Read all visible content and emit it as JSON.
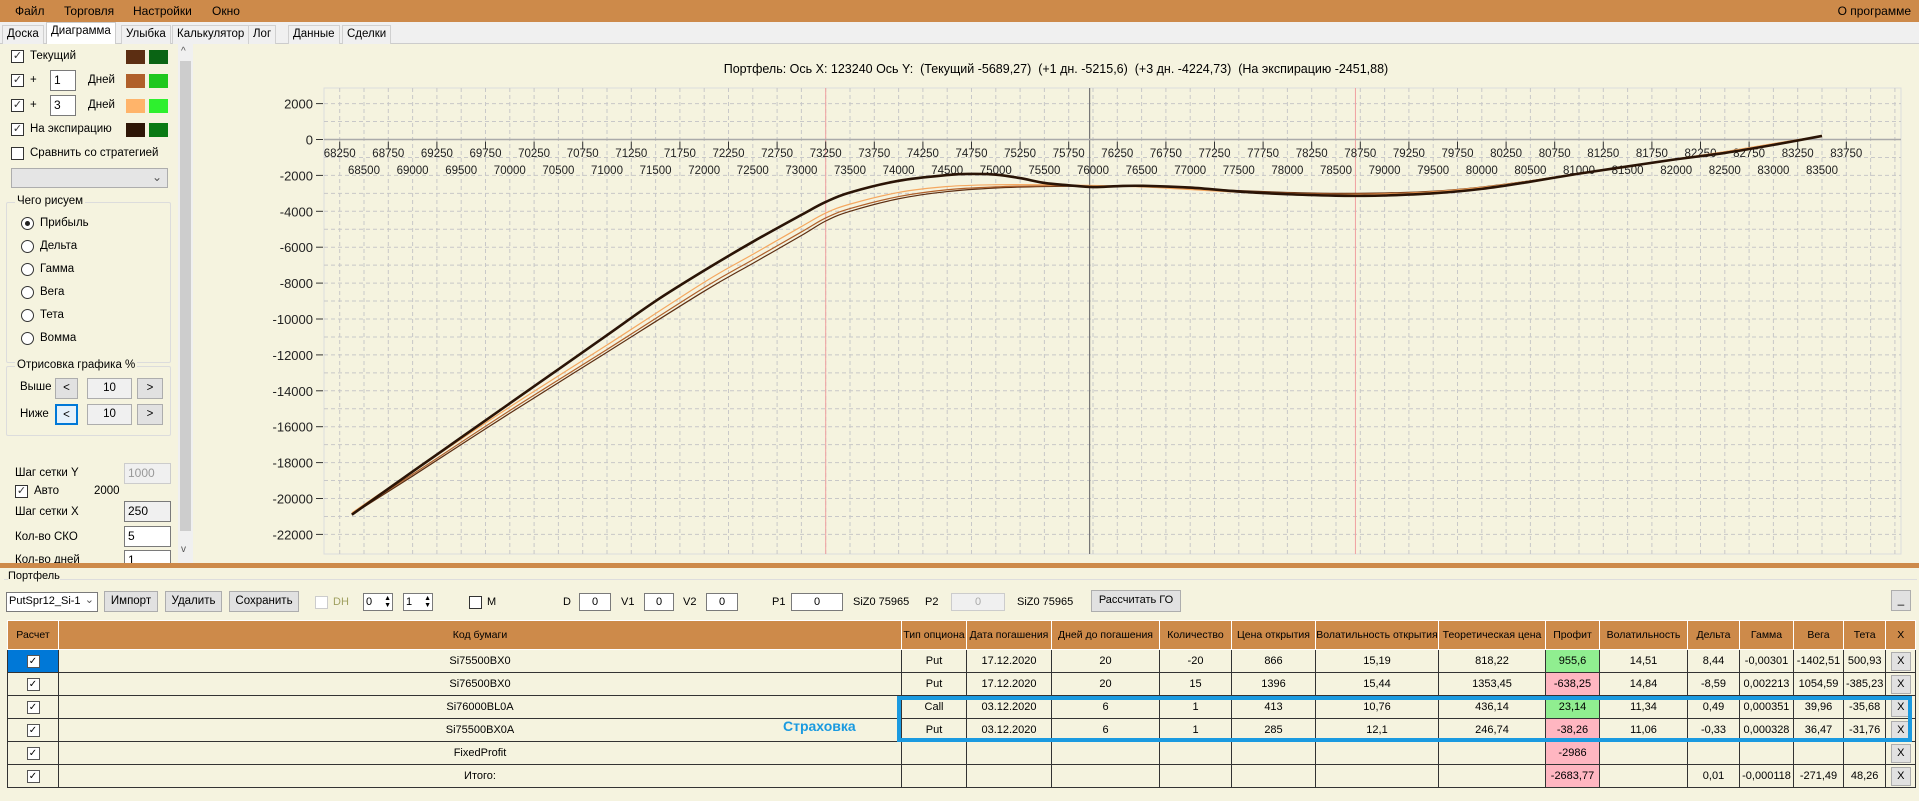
{
  "menu": {
    "items": [
      "Файл",
      "Торговля",
      "Настройки",
      "Окно"
    ],
    "about": "О программе"
  },
  "tabs": [
    "Доска",
    "Диаграмма",
    "Улыбка",
    "Калькулятор",
    "Лог",
    "Данные",
    "Сделки"
  ],
  "active_tab": "Диаграмма",
  "left_panel": {
    "series_rows": [
      {
        "label": "Текущий",
        "checked": true,
        "color1": "#5c2e12",
        "color2": "#0a6414"
      },
      {
        "label": "+",
        "days": "1",
        "days_label": "Дней",
        "checked": true,
        "color1": "#b0602a",
        "color2": "#1ec81e"
      },
      {
        "label": "+",
        "days": "3",
        "days_label": "Дней",
        "checked": true,
        "color1": "#ffb46a",
        "color2": "#2ef02e"
      },
      {
        "label": "На экспирацию",
        "checked": true,
        "color1": "#2e1606",
        "color2": "#0a7a14"
      }
    ],
    "compare_label": "Сравнить со стратегией",
    "compare_value": "",
    "draw_group": {
      "title": "Чего рисуем",
      "options": [
        "Прибыль",
        "Дельта",
        "Гамма",
        "Вега",
        "Тета",
        "Вомма"
      ],
      "selected": "Прибыль"
    },
    "range_group": {
      "title": "Отрисовка графика %",
      "above_label": "Выше",
      "above_value": "10",
      "below_label": "Ниже",
      "below_value": "10",
      "dec": "<",
      "inc": ">"
    },
    "grid_y_label": "Шаг сетки Y",
    "grid_y_value": "1000",
    "auto_label": "Авто",
    "auto_value": "2000",
    "grid_x_label": "Шаг сетки X",
    "grid_x_value": "250",
    "sko_label": "Кол-во СКО",
    "sko_value": "5",
    "days_label": "Кол-во дней",
    "days_value": "1"
  },
  "chart_title": "Портфель: Ось X: 123240 Ось Y:  (Текущий -5689,27)  (+1 дн. -5215,6)  (+3 дн. -4224,73)  (На экспирацию -2451,88)",
  "chart_data": {
    "type": "line",
    "xlim": [
      68250,
      83750
    ],
    "ylim": [
      -22000,
      2000
    ],
    "x_ticks_top": [
      "68250",
      "68750",
      "69250",
      "69750",
      "70250",
      "70750",
      "71250",
      "71750",
      "72250",
      "72750",
      "73250",
      "73750",
      "74250",
      "74750",
      "75250",
      "75750",
      "76250",
      "76750",
      "77250",
      "77750",
      "78250",
      "78750",
      "79250",
      "79750",
      "80250",
      "80750",
      "81250",
      "81750",
      "82250",
      "82750",
      "83250",
      "83750"
    ],
    "x_ticks_bottom": [
      "68500",
      "69000",
      "69500",
      "70000",
      "70500",
      "71000",
      "71500",
      "72000",
      "72500",
      "73000",
      "73500",
      "74000",
      "74500",
      "75000",
      "75500",
      "76000",
      "76500",
      "77000",
      "77500",
      "78000",
      "78500",
      "79000",
      "79500",
      "80000",
      "80500",
      "81000",
      "81500",
      "82000",
      "82500",
      "83000",
      "83500"
    ],
    "y_ticks": [
      "2000",
      "0",
      "-2000",
      "-4000",
      "-6000",
      "-8000",
      "-10000",
      "-12000",
      "-14000",
      "-16000",
      "-18000",
      "-20000",
      "-22000"
    ],
    "grid": true,
    "markers": {
      "current_price": 75965,
      "red_lines": [
        73250,
        78700
      ]
    },
    "series": [
      {
        "name": "Текущий",
        "color": "#5c2e12",
        "x": [
          68375,
          69000,
          70000,
          71000,
          72000,
          72500,
          73000,
          73250,
          73500,
          74000,
          74500,
          75000,
          75500,
          76000,
          76500,
          77000,
          77500,
          78000,
          78500,
          79000,
          79500,
          80000,
          80500,
          81000,
          81500,
          82000,
          82500,
          83000,
          83500
        ],
        "y": [
          -20900,
          -18750,
          -15250,
          -11850,
          -8450,
          -6900,
          -5350,
          -4540,
          -4000,
          -3300,
          -2900,
          -2700,
          -2620,
          -2600,
          -2620,
          -2720,
          -2850,
          -2950,
          -3000,
          -2980,
          -2880,
          -2650,
          -2300,
          -1900,
          -1500,
          -1100,
          -700,
          -250,
          200
        ]
      },
      {
        "name": "+1 дн.",
        "color": "#b0602a",
        "x": [
          68375,
          69000,
          70000,
          71000,
          72000,
          72500,
          73000,
          73250,
          73500,
          74000,
          74500,
          75000,
          75500,
          76000,
          76500,
          77000,
          77500,
          78000,
          78500,
          79000,
          79500,
          80000,
          80500,
          81000,
          81500,
          82000,
          82500,
          83000,
          83500
        ],
        "y": [
          -20850,
          -18650,
          -15100,
          -11700,
          -8250,
          -6700,
          -5150,
          -4370,
          -3850,
          -3180,
          -2800,
          -2640,
          -2580,
          -2580,
          -2620,
          -2740,
          -2880,
          -2990,
          -3040,
          -3010,
          -2900,
          -2660,
          -2300,
          -1890,
          -1490,
          -1090,
          -690,
          -240,
          200
        ]
      },
      {
        "name": "+3 дн.",
        "color": "#f5a860",
        "x": [
          68375,
          69000,
          70000,
          71000,
          72000,
          72500,
          73000,
          73250,
          73500,
          74000,
          74500,
          75000,
          75500,
          76000,
          76500,
          77000,
          77500,
          78000,
          78500,
          79000,
          79500,
          80000,
          80500,
          81000,
          81500,
          82000,
          82500,
          83000,
          83500
        ],
        "y": [
          -20800,
          -18500,
          -14900,
          -11450,
          -7950,
          -6400,
          -4850,
          -4100,
          -3600,
          -2950,
          -2620,
          -2520,
          -2520,
          -2560,
          -2640,
          -2790,
          -2940,
          -3050,
          -3090,
          -3050,
          -2920,
          -2670,
          -2300,
          -1880,
          -1480,
          -1080,
          -680,
          -230,
          200
        ]
      },
      {
        "name": "На экспирацию",
        "color": "#2a1406",
        "x": [
          68375,
          69000,
          69500,
          70000,
          70500,
          71000,
          71500,
          72000,
          72500,
          73000,
          73250,
          73500,
          74000,
          74500,
          74750,
          75000,
          75250,
          75500,
          75750,
          76000,
          76250,
          76500,
          77000,
          77500,
          78000,
          78500,
          78750,
          79000,
          79500,
          80000,
          80500,
          81000,
          81500,
          82000,
          82500,
          83000,
          83500
        ],
        "y": [
          -20900,
          -18500,
          -16600,
          -14700,
          -12800,
          -10900,
          -9000,
          -7300,
          -5700,
          -4200,
          -3480,
          -2950,
          -2300,
          -1980,
          -1920,
          -1960,
          -2150,
          -2420,
          -2550,
          -2650,
          -2600,
          -2580,
          -2680,
          -2900,
          -3050,
          -3130,
          -3140,
          -3120,
          -3000,
          -2750,
          -2350,
          -1900,
          -1500,
          -1100,
          -750,
          -300,
          200
        ]
      }
    ]
  },
  "portfolio": {
    "title": "Портфель",
    "selector": "PutSpr12_Si-1",
    "import": "Импорт",
    "delete": "Удалить",
    "save": "Сохранить",
    "dh_label": "DH",
    "spin1": "0",
    "spin2": "1",
    "m_label": "M",
    "d_label": "D",
    "d_value": "0",
    "v1_label": "V1",
    "v1_value": "0",
    "v2_label": "V2",
    "v2_value": "0",
    "p1_label": "P1",
    "p1_value": "0",
    "p1_ticker": "SiZ0 75965",
    "p2_label": "P2",
    "p2_value": "0",
    "p2_ticker": "SiZ0 75965",
    "calc_go": "Рассчитать ГО",
    "minimize": "_"
  },
  "table": {
    "headers": [
      "Расчет",
      "Код бумаги",
      "Тип опциона",
      "Дата погашения",
      "Дней до погашения",
      "Количество",
      "Цена открытия",
      "Волатильность открытия",
      "Теоретическая цена",
      "Профит",
      "Волатильность",
      "Дельта",
      "Гамма",
      "Вега",
      "Тета",
      "X"
    ],
    "rows": [
      {
        "code": "Si75500BX0",
        "type": "Put",
        "date": "17.12.2020",
        "days": "20",
        "qty": "-20",
        "open": "866",
        "vol_open": "15,19",
        "theo": "818,22",
        "profit": "955,6",
        "profit_state": "green",
        "vol": "14,51",
        "delta": "8,44",
        "gamma": "-0,00301",
        "vega": "-1402,51",
        "theta": "500,93",
        "x": "X"
      },
      {
        "code": "Si76500BX0",
        "type": "Put",
        "date": "17.12.2020",
        "days": "20",
        "qty": "15",
        "open": "1396",
        "vol_open": "15,44",
        "theo": "1353,45",
        "profit": "-638,25",
        "profit_state": "pink",
        "vol": "14,84",
        "delta": "-8,59",
        "gamma": "0,002213",
        "vega": "1054,59",
        "theta": "-385,23",
        "x": "X"
      },
      {
        "code": "Si76000BL0A",
        "type": "Call",
        "date": "03.12.2020",
        "days": "6",
        "qty": "1",
        "open": "413",
        "vol_open": "10,76",
        "theo": "436,14",
        "profit": "23,14",
        "profit_state": "green",
        "vol": "11,34",
        "delta": "0,49",
        "gamma": "0,000351",
        "vega": "39,96",
        "theta": "-35,68",
        "x": "X"
      },
      {
        "code": "Si75500BX0A",
        "type": "Put",
        "date": "03.12.2020",
        "days": "6",
        "qty": "1",
        "open": "285",
        "vol_open": "12,1",
        "theo": "246,74",
        "profit": "-38,26",
        "profit_state": "pink",
        "vol": "11,06",
        "delta": "-0,33",
        "gamma": "0,000328",
        "vega": "36,47",
        "theta": "-31,76",
        "x": "X"
      },
      {
        "code": "FixedProfit",
        "type": "",
        "date": "",
        "days": "",
        "qty": "",
        "open": "",
        "vol_open": "",
        "theo": "",
        "profit": "-2986",
        "profit_state": "pink",
        "vol": "",
        "delta": "",
        "gamma": "",
        "vega": "",
        "theta": "",
        "x": "X"
      },
      {
        "code": "Итого:",
        "type": "",
        "date": "",
        "days": "",
        "qty": "",
        "open": "",
        "vol_open": "",
        "theo": "",
        "profit": "-2683,77",
        "profit_state": "pink",
        "vol": "",
        "delta": "0,01",
        "gamma": "-0,000118",
        "vega": "-271,49",
        "theta": "48,26",
        "x": "X"
      }
    ],
    "annotation": "Страховка",
    "annotation_color": "#1a9ae0"
  }
}
